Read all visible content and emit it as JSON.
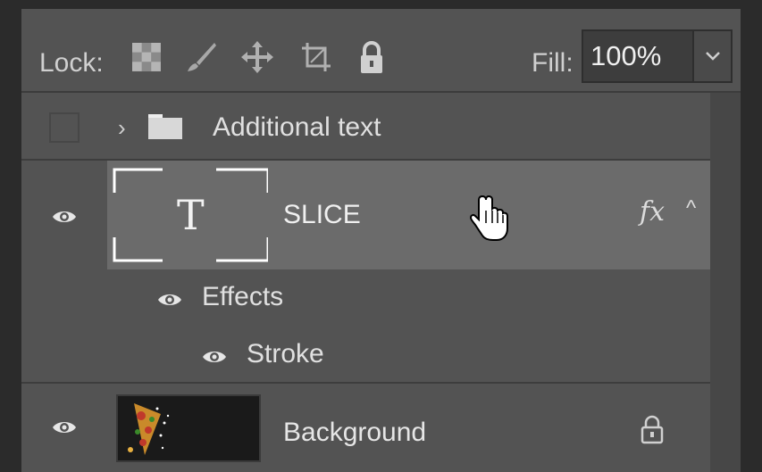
{
  "lockbar": {
    "lock_label": "Lock:",
    "icons": [
      "lock-transparent-pixels-icon",
      "lock-image-pixels-icon",
      "lock-position-icon",
      "lock-artboard-icon",
      "lock-all-icon"
    ],
    "fill_label": "Fill:",
    "fill_value": "100%"
  },
  "layers": [
    {
      "type": "group",
      "name": "Additional text",
      "visible": false,
      "icon": "folder-icon"
    },
    {
      "type": "text",
      "name": "SLICE",
      "visible": true,
      "selected": true,
      "fx_label": "fx",
      "thumbnail_glyph": "T",
      "effects": {
        "label": "Effects",
        "items": [
          {
            "name": "Stroke"
          }
        ]
      }
    },
    {
      "type": "image",
      "name": "Background",
      "visible": true,
      "locked": true
    }
  ],
  "colors": {
    "panel": "#535353",
    "selected_row": "#6b6b6b",
    "frame": "#2b2b2b"
  }
}
